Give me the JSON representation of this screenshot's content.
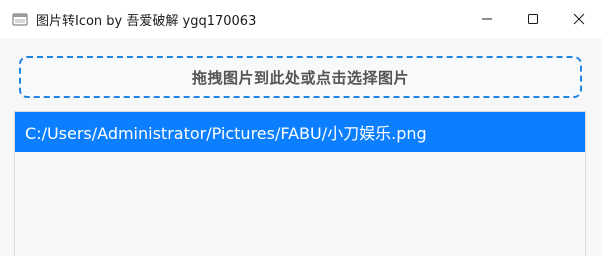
{
  "window": {
    "title": "图片转Icon by 吾爱破解 ygq170063",
    "app_icon": "app-window-icon",
    "controls": {
      "minimize_icon": "minimize-icon",
      "maximize_icon": "maximize-icon",
      "close_icon": "close-icon"
    }
  },
  "drop_zone": {
    "label": "拖拽图片到此处或点击选择图片",
    "border_color": "#1e86e2"
  },
  "file_list": {
    "items": [
      {
        "path": "C:/Users/Administrator/Pictures/FABU/小刀娱乐.png",
        "selected": true
      }
    ],
    "selection_color": "#0b7fff"
  }
}
